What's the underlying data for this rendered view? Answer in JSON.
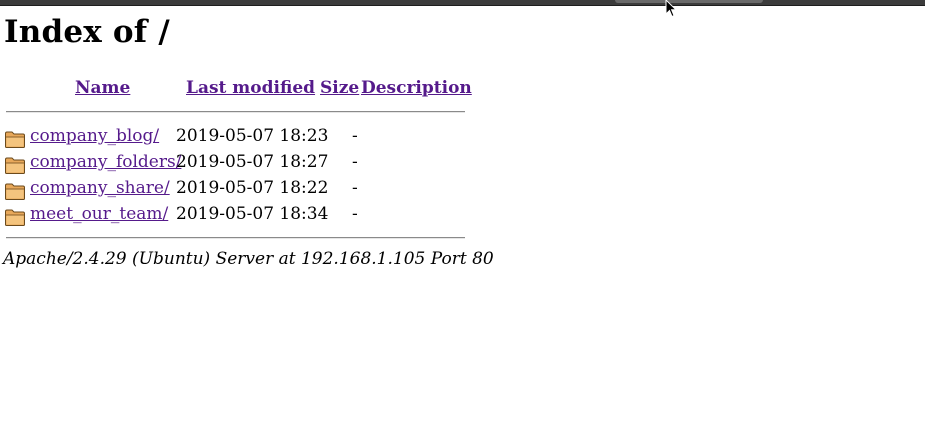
{
  "page": {
    "title": "Index of /"
  },
  "columns": {
    "name": "Name",
    "last_modified": "Last modified",
    "size": "Size",
    "description": "Description"
  },
  "entries": [
    {
      "name": "company_blog/",
      "modified": "2019-05-07 18:23",
      "size": "-",
      "icon": "folder-icon"
    },
    {
      "name": "company_folders/",
      "modified": "2019-05-07 18:27",
      "size": "-",
      "icon": "folder-icon"
    },
    {
      "name": "company_share/",
      "modified": "2019-05-07 18:22",
      "size": "-",
      "icon": "folder-icon"
    },
    {
      "name": "meet_our_team/",
      "modified": "2019-05-07 18:34",
      "size": "-",
      "icon": "folder-icon"
    }
  ],
  "footer": {
    "signature": "Apache/2.4.29 (Ubuntu) Server at 192.168.1.105 Port 80"
  },
  "colors": {
    "link_visited": "#551a8b",
    "text": "#000000",
    "background": "#ffffff"
  }
}
